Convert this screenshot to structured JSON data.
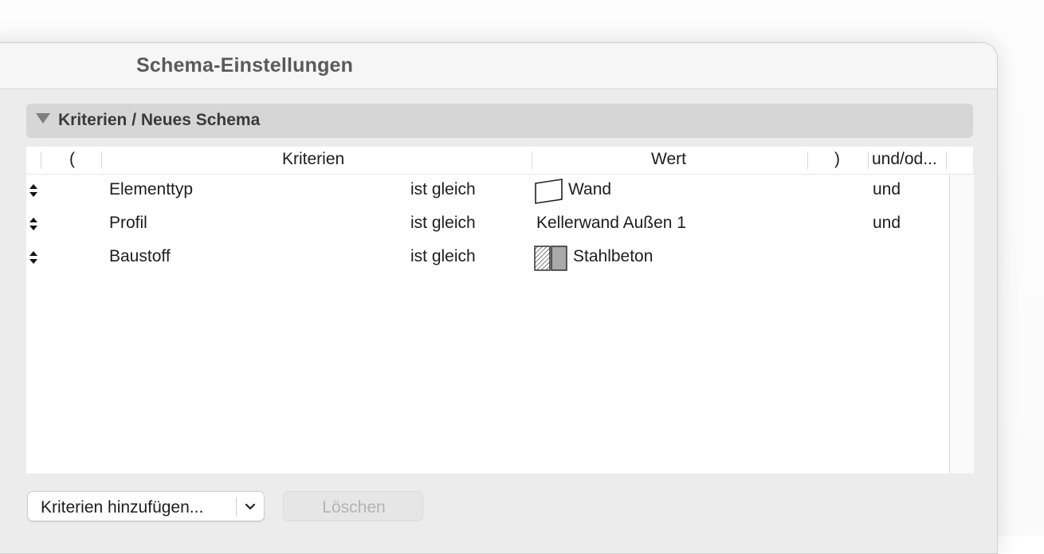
{
  "window": {
    "title": "Schema-Einstellungen"
  },
  "section": {
    "title": "Kriterien /  Neues Schema"
  },
  "table": {
    "headers": {
      "open_paren": "(",
      "criteria": "Kriterien",
      "value": "Wert",
      "close_paren": ")",
      "logic": "und/od..."
    },
    "rows": [
      {
        "criterion": "Elementtyp",
        "operator": "ist gleich",
        "value": "Wand",
        "logic": "und",
        "icon": "wall-icon"
      },
      {
        "criterion": "Profil",
        "operator": "ist gleich",
        "value": "Kellerwand Außen 1",
        "logic": "und",
        "icon": ""
      },
      {
        "criterion": "Baustoff",
        "operator": "ist gleich",
        "value": "Stahlbeton",
        "logic": "",
        "icon": "material-swatch-icon"
      }
    ]
  },
  "buttons": {
    "add_label": "Kriterien hinzufügen...",
    "delete_label": "Löschen"
  },
  "colors": {
    "section_header_bg": "#d6d6d6",
    "material_fill": "#a9a9a9"
  }
}
